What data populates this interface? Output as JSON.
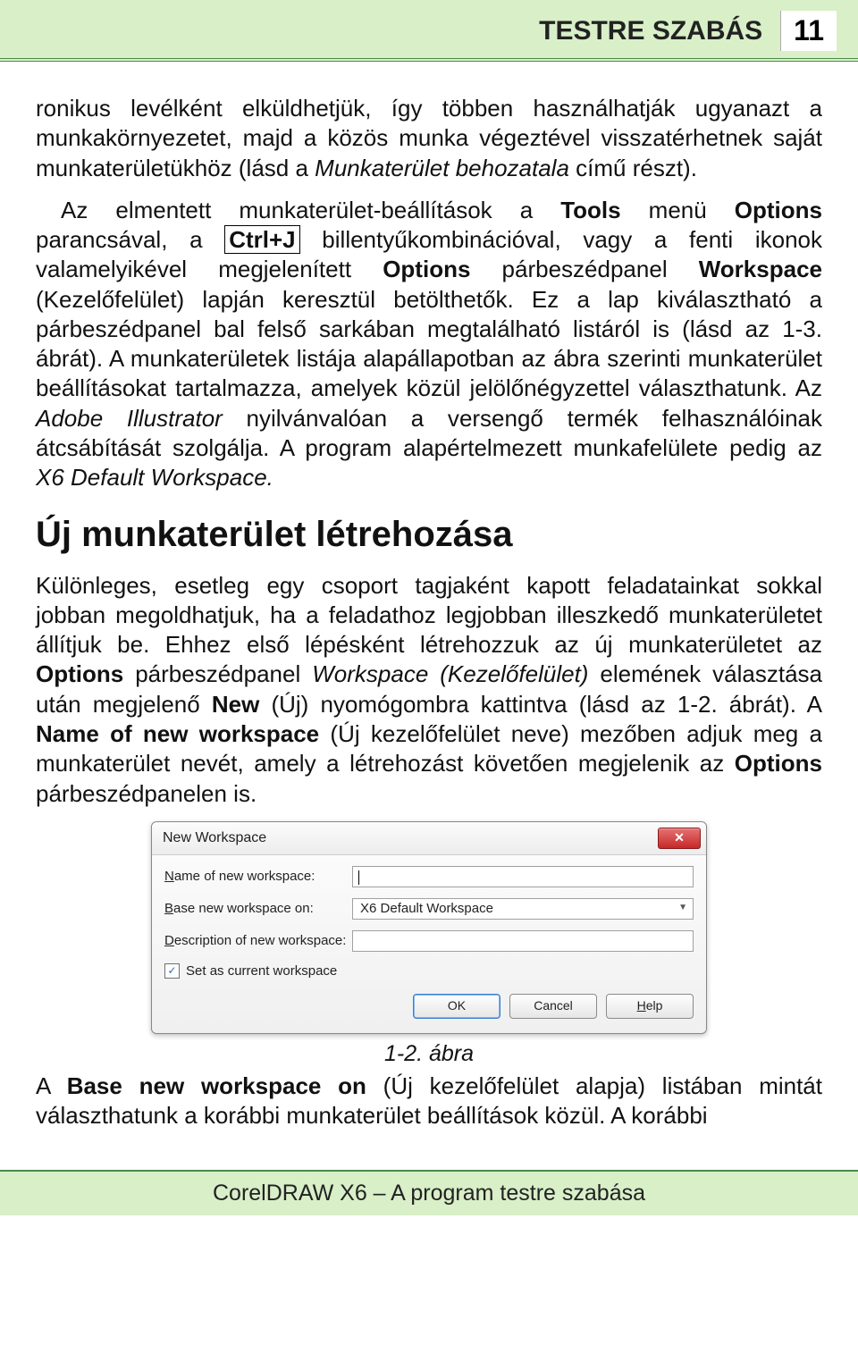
{
  "header": {
    "title": "TESTRE SZABÁS",
    "page_number": "11"
  },
  "body": {
    "p1_a": "ronikus levélként elküldhetjük, így többen használhatják ugyanazt a munkakörnyezetet, majd a közös munka végeztével visszatérhetnek saját munkaterületükhöz (lásd a ",
    "p1_b": "Munkaterület behozatala",
    "p1_c": " című részt).",
    "p2_a": "Az elmentett munkaterület-beállítások a ",
    "p2_b": "Tools",
    "p2_c": " menü ",
    "p2_d": "Options",
    "p2_e": " parancsával, a ",
    "p2_kbd": "Ctrl+J",
    "p2_f": " billentyűkombinációval, vagy a fenti ikonok valamelyikével megjelenített ",
    "p2_g": "Options",
    "p2_h": " párbeszédpanel ",
    "p2_i": "Workspace",
    "p2_j": " (Kezelőfelület) lapján keresztül betölthetők. Ez a lap kiválasztható a párbeszédpanel bal felső sarkában megtalálható listáról is (lásd az 1-3. ábrát). A munkaterületek listája alapállapotban az ábra szerinti munkaterület beállításokat tartalmazza, amelyek közül jelölőnégyzettel választhatunk. Az ",
    "p2_k": "Adobe Illustrator",
    "p2_l": " nyilvánvalóan a versengő termék felhasználóinak átcsábítását szolgálja. A program alapértelmezett munkafelülete pedig az ",
    "p2_m": "X6 Default Workspace.",
    "h2": "Új munkaterület létrehozása",
    "p3_a": "Különleges, esetleg egy csoport tagjaként kapott feladatainkat sokkal jobban megoldhatjuk, ha a feladathoz legjobban illeszkedő munkaterületet állítjuk be. Ehhez első lépésként létrehozzuk az új munkaterületet az ",
    "p3_b": "Options",
    "p3_c": " párbeszédpanel ",
    "p3_d": "Workspace (Kezelőfelület)",
    "p3_e": " elemének választása után megjelenő ",
    "p3_f": "New",
    "p3_g": " (Új) nyomógombra kattintva (lásd az 1-2. ábrát). A ",
    "p3_h": "Name of new workspace",
    "p3_i": " (Új kezelőfelület neve) mezőben adjuk meg a munkaterület nevét, amely a létrehozást követően megjelenik az ",
    "p3_j": "Options",
    "p3_k": " párbeszédpanelen is.",
    "caption": "1-2. ábra",
    "p4_a": "A ",
    "p4_b": "Base new workspace on",
    "p4_c": " (Új kezelőfelület alapja) listában mintát választhatunk a korábbi munkaterület beállítások közül. A korábbi"
  },
  "dialog": {
    "title": "New Workspace",
    "labels": {
      "name_pre": "N",
      "name_rest": "ame of new workspace:",
      "base_pre": "B",
      "base_rest": "ase new workspace on:",
      "desc_pre": "D",
      "desc_rest": "escription of new workspace:",
      "set_pre": "S",
      "set_rest": "et as current workspace"
    },
    "name_value": "",
    "base_value": "X6 Default Workspace",
    "desc_value": "",
    "set_checked": true,
    "buttons": {
      "ok": "OK",
      "cancel": "Cancel",
      "help_pre": "H",
      "help_rest": "elp"
    }
  },
  "footer": "CorelDRAW X6 – A program testre szabása"
}
